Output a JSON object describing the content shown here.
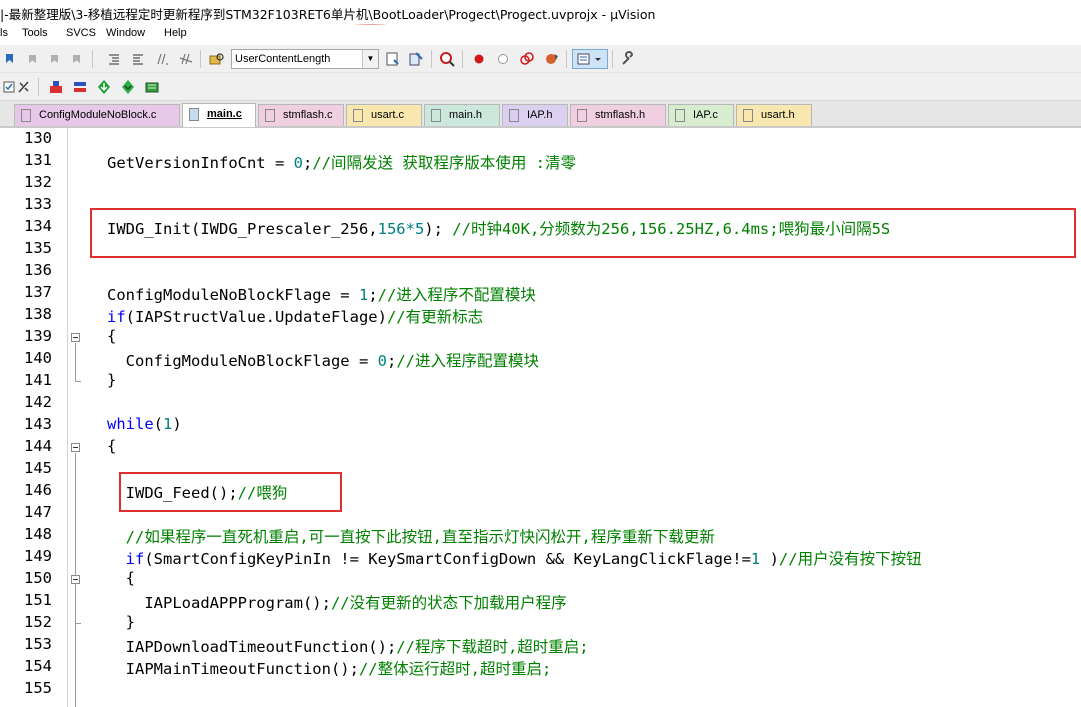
{
  "window": {
    "title_prefix": "|-最新整理版\\3-移植远程定时更新程序到STM32F103RET6单片机\\",
    "title_bootloader": "BootLoader",
    "title_suffix": "\\Progect\\Progect.uvprojx - µVision",
    "annotation_color": "#e03030"
  },
  "menubar": {
    "items": [
      "ls",
      "Tools",
      "SVCS",
      "Window",
      "Help"
    ]
  },
  "toolbar": {
    "target_combo_value": "UserContentLength"
  },
  "tabs": [
    {
      "label": "ConfigModuleNoBlock.c",
      "color": "#e8c8e8",
      "active": false
    },
    {
      "label": "main.c",
      "color": "#c8dcf0",
      "active": true
    },
    {
      "label": "stmflash.c",
      "color": "#f0d0e0",
      "active": false
    },
    {
      "label": "usart.c",
      "color": "#f8e8b0",
      "active": false
    },
    {
      "label": "main.h",
      "color": "#cce8dc",
      "active": false
    },
    {
      "label": "IAP.h",
      "color": "#dcd0f0",
      "active": false
    },
    {
      "label": "stmflash.h",
      "color": "#f0d0e0",
      "active": false
    },
    {
      "label": "IAP.c",
      "color": "#d8ecd0",
      "active": false
    },
    {
      "label": "usart.h",
      "color": "#f8e8b0",
      "active": false
    }
  ],
  "editor": {
    "line_numbers": [
      "130",
      "131",
      "132",
      "133",
      "134",
      "135",
      "136",
      "137",
      "138",
      "139",
      "140",
      "141",
      "142",
      "143",
      "144",
      "145",
      "146",
      "147",
      "148",
      "149",
      "150",
      "151",
      "152",
      "153",
      "154",
      "155"
    ],
    "lines": {
      "l131": {
        "code": "GetVersionInfoCnt = ",
        "num": "0",
        "rest": ";",
        "comment": "//间隔发送 获取程序版本使用 :清零"
      },
      "l134": {
        "code": "IWDG_Init(IWDG_Prescaler_256,",
        "num": "156*5",
        "rest": "); ",
        "comment": "//时钟40K,分频数为256,156.25HZ,6.4ms;喂狗最小间隔5S"
      },
      "l137": {
        "code": "ConfigModuleNoBlockFlage = ",
        "num": "1",
        "rest": ";",
        "comment": "//进入程序不配置模块"
      },
      "l138": {
        "kw": "if",
        "code": "(IAPStructValue.UpdateFlage)",
        "comment": "//有更新标志"
      },
      "l139": {
        "code": "{"
      },
      "l140": {
        "code": "  ConfigModuleNoBlockFlage = ",
        "num": "0",
        "rest": ";",
        "comment": "//进入程序配置模块"
      },
      "l141": {
        "code": "}"
      },
      "l143": {
        "kw": "while",
        "code": "(",
        "num": "1",
        "rest": ")"
      },
      "l144": {
        "code": "{"
      },
      "l146": {
        "code": "  IWDG_Feed();",
        "comment": "//喂狗"
      },
      "l148": {
        "comment": "  //如果程序一直死机重启,可一直按下此按钮,直至指示灯快闪松开,程序重新下载更新"
      },
      "l149": {
        "kw": "  if",
        "code": "(SmartConfigKeyPinIn != KeySmartConfigDown && KeyLangClickFlage!=",
        "num": "1",
        "rest": " )",
        "comment": "//用户没有按下按钮"
      },
      "l150": {
        "code": "  {"
      },
      "l151": {
        "code": "    IAPLoadAPPProgram();",
        "comment": "//没有更新的状态下加载用户程序"
      },
      "l152": {
        "code": "  }"
      },
      "l153": {
        "code": "  IAPDownloadTimeoutFunction();",
        "comment": "//程序下载超时,超时重启;"
      },
      "l154": {
        "code": "  IAPMainTimeoutFunction();",
        "comment": "//整体运行超时,超时重启;"
      }
    }
  },
  "icons": [
    "bookmark-icon",
    "bookmark-prev-icon",
    "bookmark-next-icon",
    "bookmark-clear-icon",
    "indent-icon",
    "outdent-icon",
    "comment-icon",
    "uncomment-icon",
    "find-in-files-icon",
    "combo-arrow-icon",
    "configure-icon",
    "insert-icon",
    "debug-icon",
    "breakpoint-icon",
    "breakpoint-disable-icon",
    "breakpoint-kill-icon",
    "window-layout-icon",
    "wrench-icon",
    "options-icon",
    "translate-icon",
    "build-icon",
    "rebuild-icon",
    "download-icon",
    "load-icon"
  ]
}
